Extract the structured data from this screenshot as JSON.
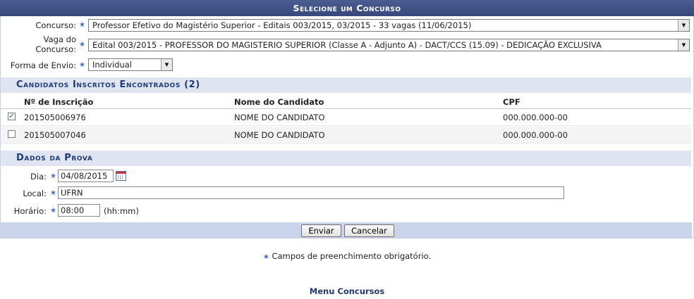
{
  "header": {
    "title": "Selecione um Concurso"
  },
  "form": {
    "concurso": {
      "label": "Concurso:",
      "value": "Professor Efetivo do Magistério Superior - Editais 003/2015, 03/2015 - 33 vagas (11/06/2015)"
    },
    "vaga": {
      "label_line1": "Vaga do",
      "label_line2": "Concurso:",
      "value": "Edital 003/2015 - PROFESSOR DO MAGISTERIO SUPERIOR (Classe A - Adjunto A) - DACT/CCS (15.09) - DEDICAÇÃO EXCLUSIVA"
    },
    "forma_envio": {
      "label": "Forma de Envio:",
      "value": "Individual"
    }
  },
  "candidatos": {
    "title": "Candidatos Inscritos Encontrados (2)",
    "columns": [
      "Nº de Inscrição",
      "Nome do Candidato",
      "CPF"
    ],
    "rows": [
      {
        "checked": true,
        "inscricao": "201505006976",
        "nome": "NOME DO CANDIDATO",
        "cpf": "000.000.000-00"
      },
      {
        "checked": false,
        "inscricao": "201505007046",
        "nome": "NOME DO CANDIDATO",
        "cpf": "000.000.000-00"
      }
    ]
  },
  "prova": {
    "title": "Dados da Prova",
    "dia": {
      "label": "Dia:",
      "value": "04/08/2015"
    },
    "local": {
      "label": "Local:",
      "value": "UFRN"
    },
    "horario": {
      "label": "Horário:",
      "value": "08:00",
      "hint": "(hh:mm)"
    }
  },
  "actions": {
    "enviar": "Enviar",
    "cancelar": "Cancelar"
  },
  "required_note": "Campos de preenchimento obrigatório.",
  "menu_link": "Menu Concursos",
  "colors": {
    "header_bg": "#3f5287",
    "section_bg": "#dee5f0",
    "section_text": "#1f3a75",
    "required_star": "#3f6fd0"
  },
  "icons": {
    "required": "star-icon",
    "calendar": "calendar-icon",
    "dropdown": "chevron-down-icon",
    "checkbox": "checkbox-icon"
  }
}
